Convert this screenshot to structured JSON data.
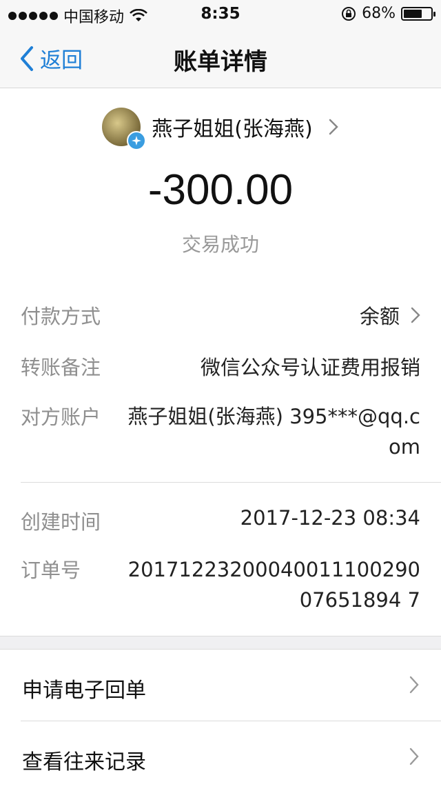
{
  "status_bar": {
    "carrier": "中国移动",
    "time": "8:35",
    "battery": "68%",
    "battery_level": 0.68
  },
  "nav": {
    "back_label": "返回",
    "title": "账单详情"
  },
  "header": {
    "payee_name": "燕子姐姐(张海燕)",
    "amount": "-300.00",
    "status": "交易成功"
  },
  "details": {
    "payment_method_label": "付款方式",
    "payment_method_value": "余额",
    "remark_label": "转账备注",
    "remark_value": "微信公众号认证费用报销",
    "account_label": "对方账户",
    "account_value": "燕子姐姐(张海燕) 395***@qq.com",
    "created_label": "创建时间",
    "created_value": "2017-12-23 08:34",
    "order_label": "订单号",
    "order_value": "2017122320004001110029007651894 7"
  },
  "menu": {
    "receipt_label": "申请电子回单",
    "history_label": "查看往来记录"
  },
  "colors": {
    "accent": "#1f7fd6",
    "badge": "#3a9de0"
  },
  "icons": [
    "signal-dots-icon",
    "wifi-icon",
    "rotation-lock-icon",
    "battery-icon",
    "back-chevron-icon",
    "verified-badge-icon",
    "chevron-right-icon"
  ]
}
